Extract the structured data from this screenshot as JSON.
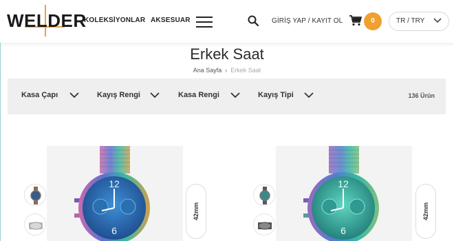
{
  "header": {
    "logo": "WELDER",
    "nav": [
      "KOLEKSİYONLAR",
      "AKSESUAR"
    ],
    "login": "GİRİŞ YAP / KAYIT OL",
    "cart_count": "0",
    "locale": "TR / TRY"
  },
  "page": {
    "title": "Erkek Saat",
    "breadcrumb": [
      "Ana Sayfa",
      "Erkek Saat"
    ]
  },
  "filters": {
    "items": [
      "Kasa Çapı",
      "Kayış Rengi",
      "Kasa Rengi",
      "Kayış Tipi"
    ],
    "count": "136 Ürün"
  },
  "products": [
    {
      "size": "42mm",
      "dial_color": "#2a5fa8"
    },
    {
      "size": "42mm",
      "dial_color": "#3aa89a"
    }
  ],
  "colors": {
    "accent": "#f0a030",
    "filter_bg": "#efefef"
  }
}
